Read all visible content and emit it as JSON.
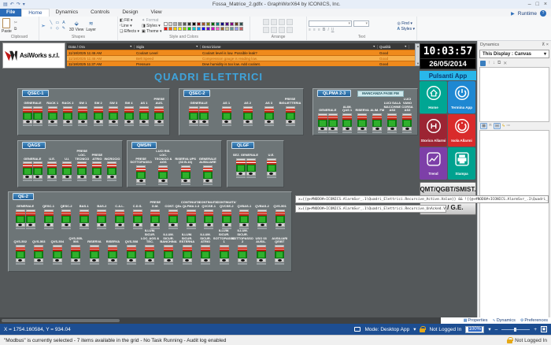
{
  "window": {
    "title": "Fossa_Matrice_2.gdfx - GraphWorX64 by ICONICS, Inc."
  },
  "ribbon": {
    "tabs": [
      "File",
      "Home",
      "Dynamics",
      "Controls",
      "Design",
      "View"
    ],
    "active_tab": "Home",
    "runtime_label": "Runtime",
    "group_labels": [
      "Clipboard",
      "Shapes",
      "Style and Colors",
      "Arrange",
      "Text"
    ],
    "buttons": {
      "paste": "Paste",
      "fill": "Fill",
      "line": "Line",
      "effects": "Effects",
      "format": "Format",
      "styles": "Styles",
      "theme": "Theme",
      "view3d": "3D View",
      "layer": "Layer",
      "find": "Find",
      "text_styles": "Styles"
    },
    "palette_row1": [
      "#ffffff",
      "#d8d8d8",
      "#b0b0b0",
      "#888888",
      "#585858",
      "#303030",
      "#000000",
      "#8b0000",
      "#a0522d",
      "#808000",
      "#006400",
      "#008080",
      "#000080",
      "#4b0082",
      "#800080",
      "#654321",
      "#2f4f4f"
    ],
    "palette_row2": [
      "#ff0000",
      "#ff6600",
      "#ffcc00",
      "#ffff00",
      "#99cc00",
      "#00cc00",
      "#00cccc",
      "#0099ff",
      "#0000ff",
      "#6600cc",
      "#cc00cc",
      "#ff66cc",
      "#996633",
      "#cccc99",
      "#669999",
      "#9999ff",
      "#cc6666"
    ]
  },
  "logo": {
    "company": "AsiWorks s.r.l."
  },
  "alarm_grid": {
    "columns": [
      "Data / Ora",
      "Sigla",
      "Descrizione",
      "Qualità"
    ],
    "rows": [
      {
        "time": "11/18/2025 11:46 AM",
        "sigla": "Coolant Level",
        "desc": "Coolant level is low.  Possible leak?",
        "quality": "Good",
        "selected": false
      },
      {
        "time": "11/18/2025 11:46 AM",
        "sigla": "Belt Speed",
        "desc": "Compression gauge is reading low.",
        "quality": "Good",
        "selected": true
      },
      {
        "time": "11/18/2025 11:37 AM",
        "sigla": "Pressure",
        "desc": "Dew humidity is too low.  Add coolant.",
        "quality": "Good",
        "selected": false
      }
    ]
  },
  "canvas": {
    "title": "QUADRI ELETTRICI"
  },
  "panels": [
    {
      "name": "QSEC-1",
      "rows": [
        [
          {
            "label": "GENERALE",
            "double": true
          },
          {
            "label": "RACK 1"
          },
          {
            "label": "RACK 2"
          },
          {
            "label": "SW 1"
          },
          {
            "label": "SW 2"
          },
          {
            "label": "SW 3"
          },
          {
            "label": "SW 4"
          },
          {
            "label": "AS 1"
          },
          {
            "label": "PRESE AUS."
          }
        ]
      ]
    },
    {
      "name": "QSEC-2",
      "rows": [
        [
          {
            "label": "GENERALE",
            "double": true
          },
          {
            "label": "AS 1"
          },
          {
            "label": "AS 2"
          },
          {
            "label": "AS 3"
          },
          {
            "label": "PRESE BIGLIETTERIA"
          }
        ]
      ]
    },
    {
      "name": "QLPMA 2-3",
      "banner": "MANCANZA FASE FM",
      "rows": [
        [
          {
            "label": "GENERALE",
            "double": true
          },
          {
            "label": "ALIM. QAS 1"
          },
          {
            "label": "RISERVA"
          },
          {
            "label": "ALIM. FM"
          },
          {
            "label": "LUCI SALA MACCHINE AS3"
          },
          {
            "label": "LUCI VANO CORSA AS3"
          }
        ]
      ]
    },
    {
      "name": "QAGS",
      "rows": [
        [
          {
            "label": "GENERALE",
            "double": true
          },
          {
            "label": "U.E."
          },
          {
            "label": "U.I."
          },
          {
            "label": "PRESE LOC. TECNICO"
          },
          {
            "label": "PRESE ATRIO"
          },
          {
            "label": "INCROCIO"
          }
        ]
      ]
    },
    {
      "name": "QMS/N",
      "rows": [
        [
          {
            "label": "PRESE SOTTOPASSO"
          },
          {
            "label": "LUCI RIS. LOC. TECNICO & AGS"
          },
          {
            "label": "RISERVA UPS (33 B-16)"
          },
          {
            "label": "GENERALE AUSILIARE"
          }
        ]
      ]
    },
    {
      "name": "QLGF",
      "rows": [
        [
          {
            "label": "SEZ. GENERALE",
            "double": true
          },
          {
            "label": "U.E."
          }
        ]
      ]
    },
    {
      "name": "QE-2",
      "rows": [
        [
          {
            "label": "GENERALE",
            "double": true
          },
          {
            "label": "QESC-1"
          },
          {
            "label": "QESC-2"
          },
          {
            "label": "BAS-1"
          },
          {
            "label": "BAS-2"
          },
          {
            "label": "C.A.L."
          },
          {
            "label": "C.D.S."
          },
          {
            "label": "PRESE D.M."
          },
          {
            "label": "CONT. QSs"
          },
          {
            "label": "CONTINUITA' QLPMA 2-3"
          },
          {
            "label": "CONTINUITA' QVCSE-1"
          },
          {
            "label": "CONTINUITA' QVCSE-2"
          },
          {
            "label": "QVBAS-1"
          },
          {
            "label": "QVBAS-2"
          },
          {
            "label": "QVS-501"
          }
        ],
        [
          {
            "label": "QVS-502"
          },
          {
            "label": "QVS-503"
          },
          {
            "label": "QVS-504"
          },
          {
            "label": "QVS-505-506"
          },
          {
            "label": "RISERVA"
          },
          {
            "label": "RISERVA"
          },
          {
            "label": "QVS-508"
          },
          {
            "label": "ILLUM. SICUR. LOC. AGS & TEC."
          },
          {
            "label": "ILLUM. SICUR. BANCHINA"
          },
          {
            "label": "ILLUM. SICUR. ESTERNA"
          },
          {
            "label": "ILLUM. SICUR. ATRIO"
          },
          {
            "label": "ILLUM. SICUR. SOTTOPASSO 1"
          },
          {
            "label": "ILLUM. SICUR. SOTTOPASSO 2"
          },
          {
            "label": "USO 03 AUSIL."
          },
          {
            "label": "AUSILIARI QE/BT"
          }
        ]
      ]
    }
  ],
  "tooltip": {
    "line1": "x={{@+#NODO#+ICONICS.AlarmSvr_.1\\Quadri_Elettrici.Recursive_Active.Value}} && !{{@+#NODO#+ICONICS.AlarmSvr_.1\\Quadri_Elettrici.Recursive_UnAcked.Value}}",
    "line2": "x={{@+#NODO#+ICONICS.AlarmSvr_.1\\Quadri_Elettrici.Recursive_UnAcked.Value}}"
  },
  "sidebar": {
    "clock": "10:03:57",
    "date": "26/05/2014",
    "header": "Pulsanti App",
    "apps": [
      {
        "label": "Home",
        "color": "#00a693",
        "icon": "home"
      },
      {
        "label": "Termina App",
        "color": "#1e88d2",
        "icon": "power"
      },
      {
        "label": "Storico Allarmi",
        "color": "#9c2433",
        "icon": "history"
      },
      {
        "label": "Isola Allarmi",
        "color": "#d92b2b",
        "icon": "alarm"
      },
      {
        "label": "Trend",
        "color": "#7d3fa8",
        "icon": "trend"
      },
      {
        "label": "Stampa",
        "color": "#00a28f",
        "icon": "print"
      }
    ],
    "qmt_button": "QMT/QGBT/SMIST.",
    "ups_button": "UPS / G.E."
  },
  "dynamics_panel": {
    "title": "Dynamics",
    "selector": "This Display : Canvas",
    "footer_tabs": [
      {
        "label": "Properties",
        "icon": "grid"
      },
      {
        "label": "Dynamics",
        "icon": "wave"
      },
      {
        "label": "Preferences",
        "icon": "gear"
      }
    ]
  },
  "status_bar": {
    "coords": "X = 1754.160584, Y = 934.04",
    "mode": "Mode: Desktop App",
    "login": "Not Logged In",
    "zoom": "100%"
  },
  "bottom_bar": {
    "message": "\"Modbus\" is currently selected - 7 items available in the grid - No Task Running - Audit log enabled",
    "login": "Not Logged In"
  }
}
